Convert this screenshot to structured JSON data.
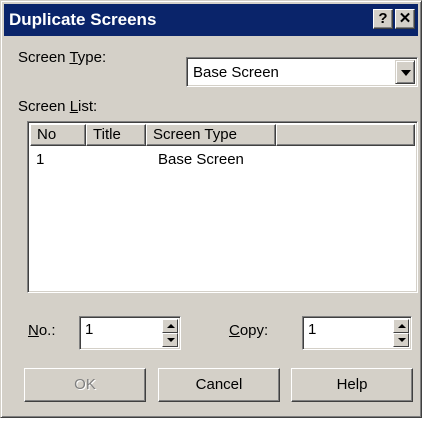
{
  "dialog": {
    "title": "Duplicate Screens",
    "help_button": "?",
    "close_button": "✕"
  },
  "screen_type": {
    "label_pre": "Screen ",
    "label_key": "T",
    "label_post": "ype:",
    "value": "Base Screen"
  },
  "screen_list": {
    "label_pre": "Screen ",
    "label_key": "L",
    "label_post": "ist:",
    "columns": [
      "No",
      "Title",
      "Screen Type"
    ],
    "rows": [
      {
        "no": "1",
        "title": "",
        "screen_type": "Base Screen"
      }
    ]
  },
  "no_field": {
    "label_key": "N",
    "label_post": "o.:",
    "value": "1"
  },
  "copy_field": {
    "label_key": "C",
    "label_post": "opy:",
    "value": "1"
  },
  "buttons": {
    "ok": "OK",
    "cancel": "Cancel",
    "help": "Help"
  }
}
